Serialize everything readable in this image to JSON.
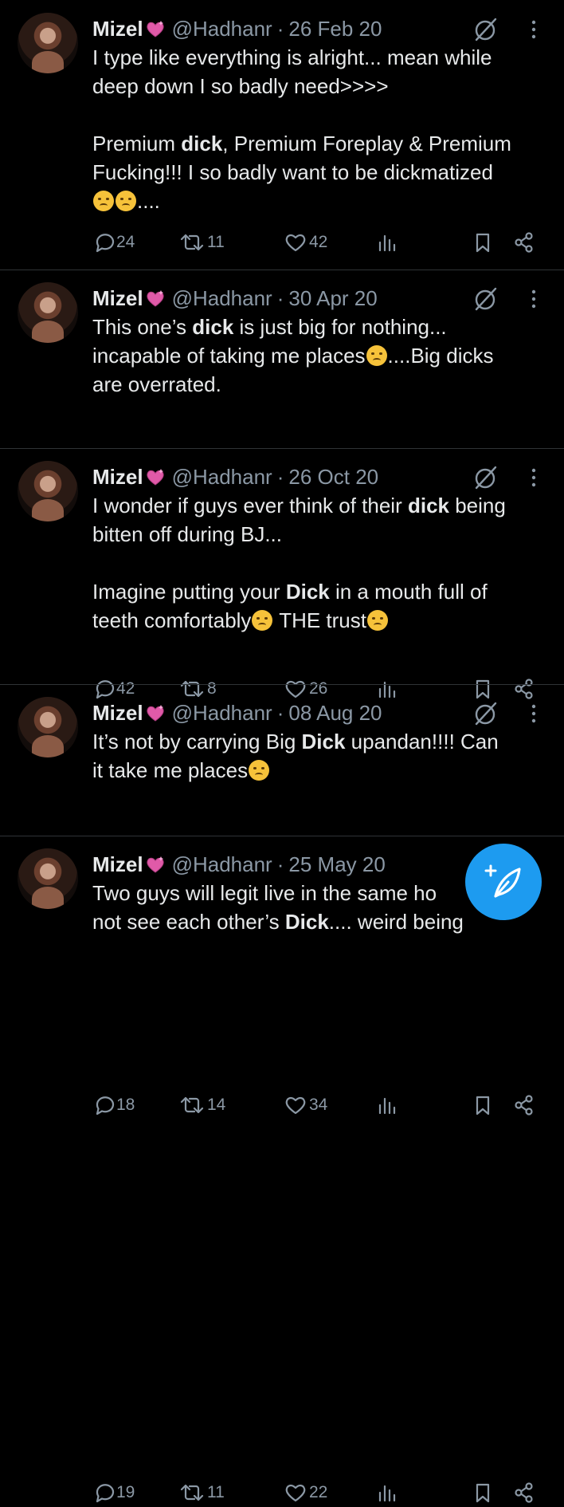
{
  "colors": {
    "background": "#000000",
    "text": "#e7e9ea",
    "muted": "#8b98a5",
    "accent": "#1d9bf0",
    "divider": "#2f3336"
  },
  "tweets": [
    {
      "name": "Mizel",
      "handle": "@Hadhanr",
      "sep": "·",
      "date": "26 Feb 20",
      "lines": [
        [
          "I type like everything is alright... mean while"
        ],
        [
          "deep down I so badly need>>>>"
        ],
        [],
        [
          "Premium ",
          {
            "b": "dick"
          },
          ", Premium Foreplay & Premium"
        ],
        [
          "Fucking!!! I so badly want to be dickmatized"
        ],
        [
          {
            "emoji": "weary"
          },
          {
            "emoji": "weary"
          },
          "...."
        ]
      ],
      "replies": "24",
      "retweets": "11",
      "likes": "42"
    },
    {
      "name": "Mizel",
      "handle": "@Hadhanr",
      "sep": "·",
      "date": "30 Apr 20",
      "lines": [
        [
          "This one’s ",
          {
            "b": "dick"
          },
          " is just big for nothing..."
        ],
        [
          "incapable of taking me places",
          {
            "emoji": "unamused"
          },
          "....Big dicks"
        ],
        [
          "are overrated."
        ]
      ],
      "replies": "42",
      "retweets": "8",
      "likes": "26"
    },
    {
      "name": "Mizel",
      "handle": "@Hadhanr",
      "sep": "·",
      "date": "26 Oct 20",
      "lines": [
        [
          "I wonder if guys ever think of their ",
          {
            "b": "dick"
          },
          " being"
        ],
        [
          "bitten off during BJ..."
        ],
        [],
        [
          "Imagine putting your ",
          {
            "b": "Dick"
          },
          " in a mouth full of"
        ],
        [
          "teeth comfortably",
          {
            "emoji": "confounded"
          },
          " THE trust",
          {
            "emoji": "woozy"
          }
        ]
      ],
      "replies": "18",
      "retweets": "14",
      "likes": "34"
    },
    {
      "name": "Mizel",
      "handle": "@Hadhanr",
      "sep": "·",
      "date": "08 Aug 20",
      "lines": [
        [
          "It’s not by carrying Big ",
          {
            "b": "Dick"
          },
          " upandan!!!! Can"
        ],
        [
          "it take me places",
          {
            "emoji": "unamused"
          }
        ]
      ],
      "replies": "19",
      "retweets": "11",
      "likes": "22"
    },
    {
      "name": "Mizel",
      "handle": "@Hadhanr",
      "sep": "·",
      "date": "25 May 20",
      "lines": [
        [
          "Two guys will legit live in the same ho"
        ],
        [
          "not see each other’s ",
          {
            "b": "Dick"
          },
          ".... weird being"
        ]
      ],
      "replies": "",
      "retweets": "",
      "likes": ""
    }
  ],
  "icons": {
    "reply": "reply-icon",
    "retweet": "retweet-icon",
    "like": "heart-icon",
    "views": "views-icon",
    "bookmark": "bookmark-icon",
    "share": "share-icon",
    "grok": "grok-icon",
    "more": "more-icon",
    "compose": "compose-icon"
  }
}
